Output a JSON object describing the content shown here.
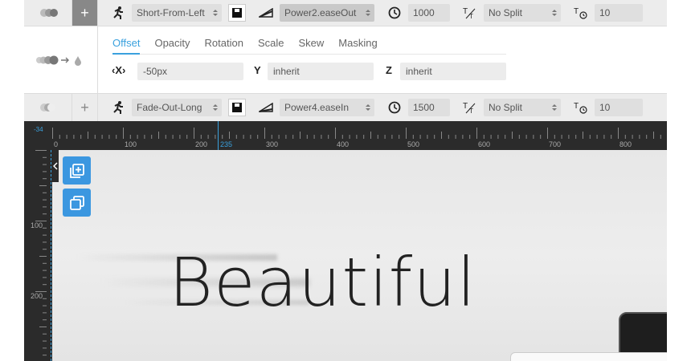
{
  "row1": {
    "animation": "Short-From-Left",
    "easing": "Power2.easeOut",
    "duration": "1000",
    "split": "No Split",
    "stagger": "10"
  },
  "row2": {
    "tabs": [
      "Offset",
      "Opacity",
      "Rotation",
      "Scale",
      "Skew",
      "Masking"
    ],
    "x_label": "X",
    "x_value": "-50px",
    "y_label": "Y",
    "y_value": "inherit",
    "z_label": "Z",
    "z_value": "inherit"
  },
  "row3": {
    "animation": "Fade-Out-Long",
    "easing": "Power4.easeIn",
    "duration": "1500",
    "split": "No Split",
    "stagger": "10"
  },
  "ruler": {
    "h_labels": [
      "0",
      "100",
      "200",
      "235",
      "300",
      "400",
      "500",
      "600",
      "700",
      "800"
    ],
    "v_labels": [
      "100",
      "200"
    ],
    "corner": "-34"
  },
  "stage": {
    "headline": "Beautiful"
  },
  "colors": {
    "accent": "#3aa1de",
    "tool_blue": "#3b97e0",
    "ruler_bg": "#2b2b2b"
  },
  "icons": [
    "runner-icon",
    "save-icon",
    "easing-icon",
    "clock-icon",
    "split-text-icon",
    "stagger-icon",
    "add-layer-icon",
    "duplicate-icon",
    "collapse-arrow-icon"
  ]
}
